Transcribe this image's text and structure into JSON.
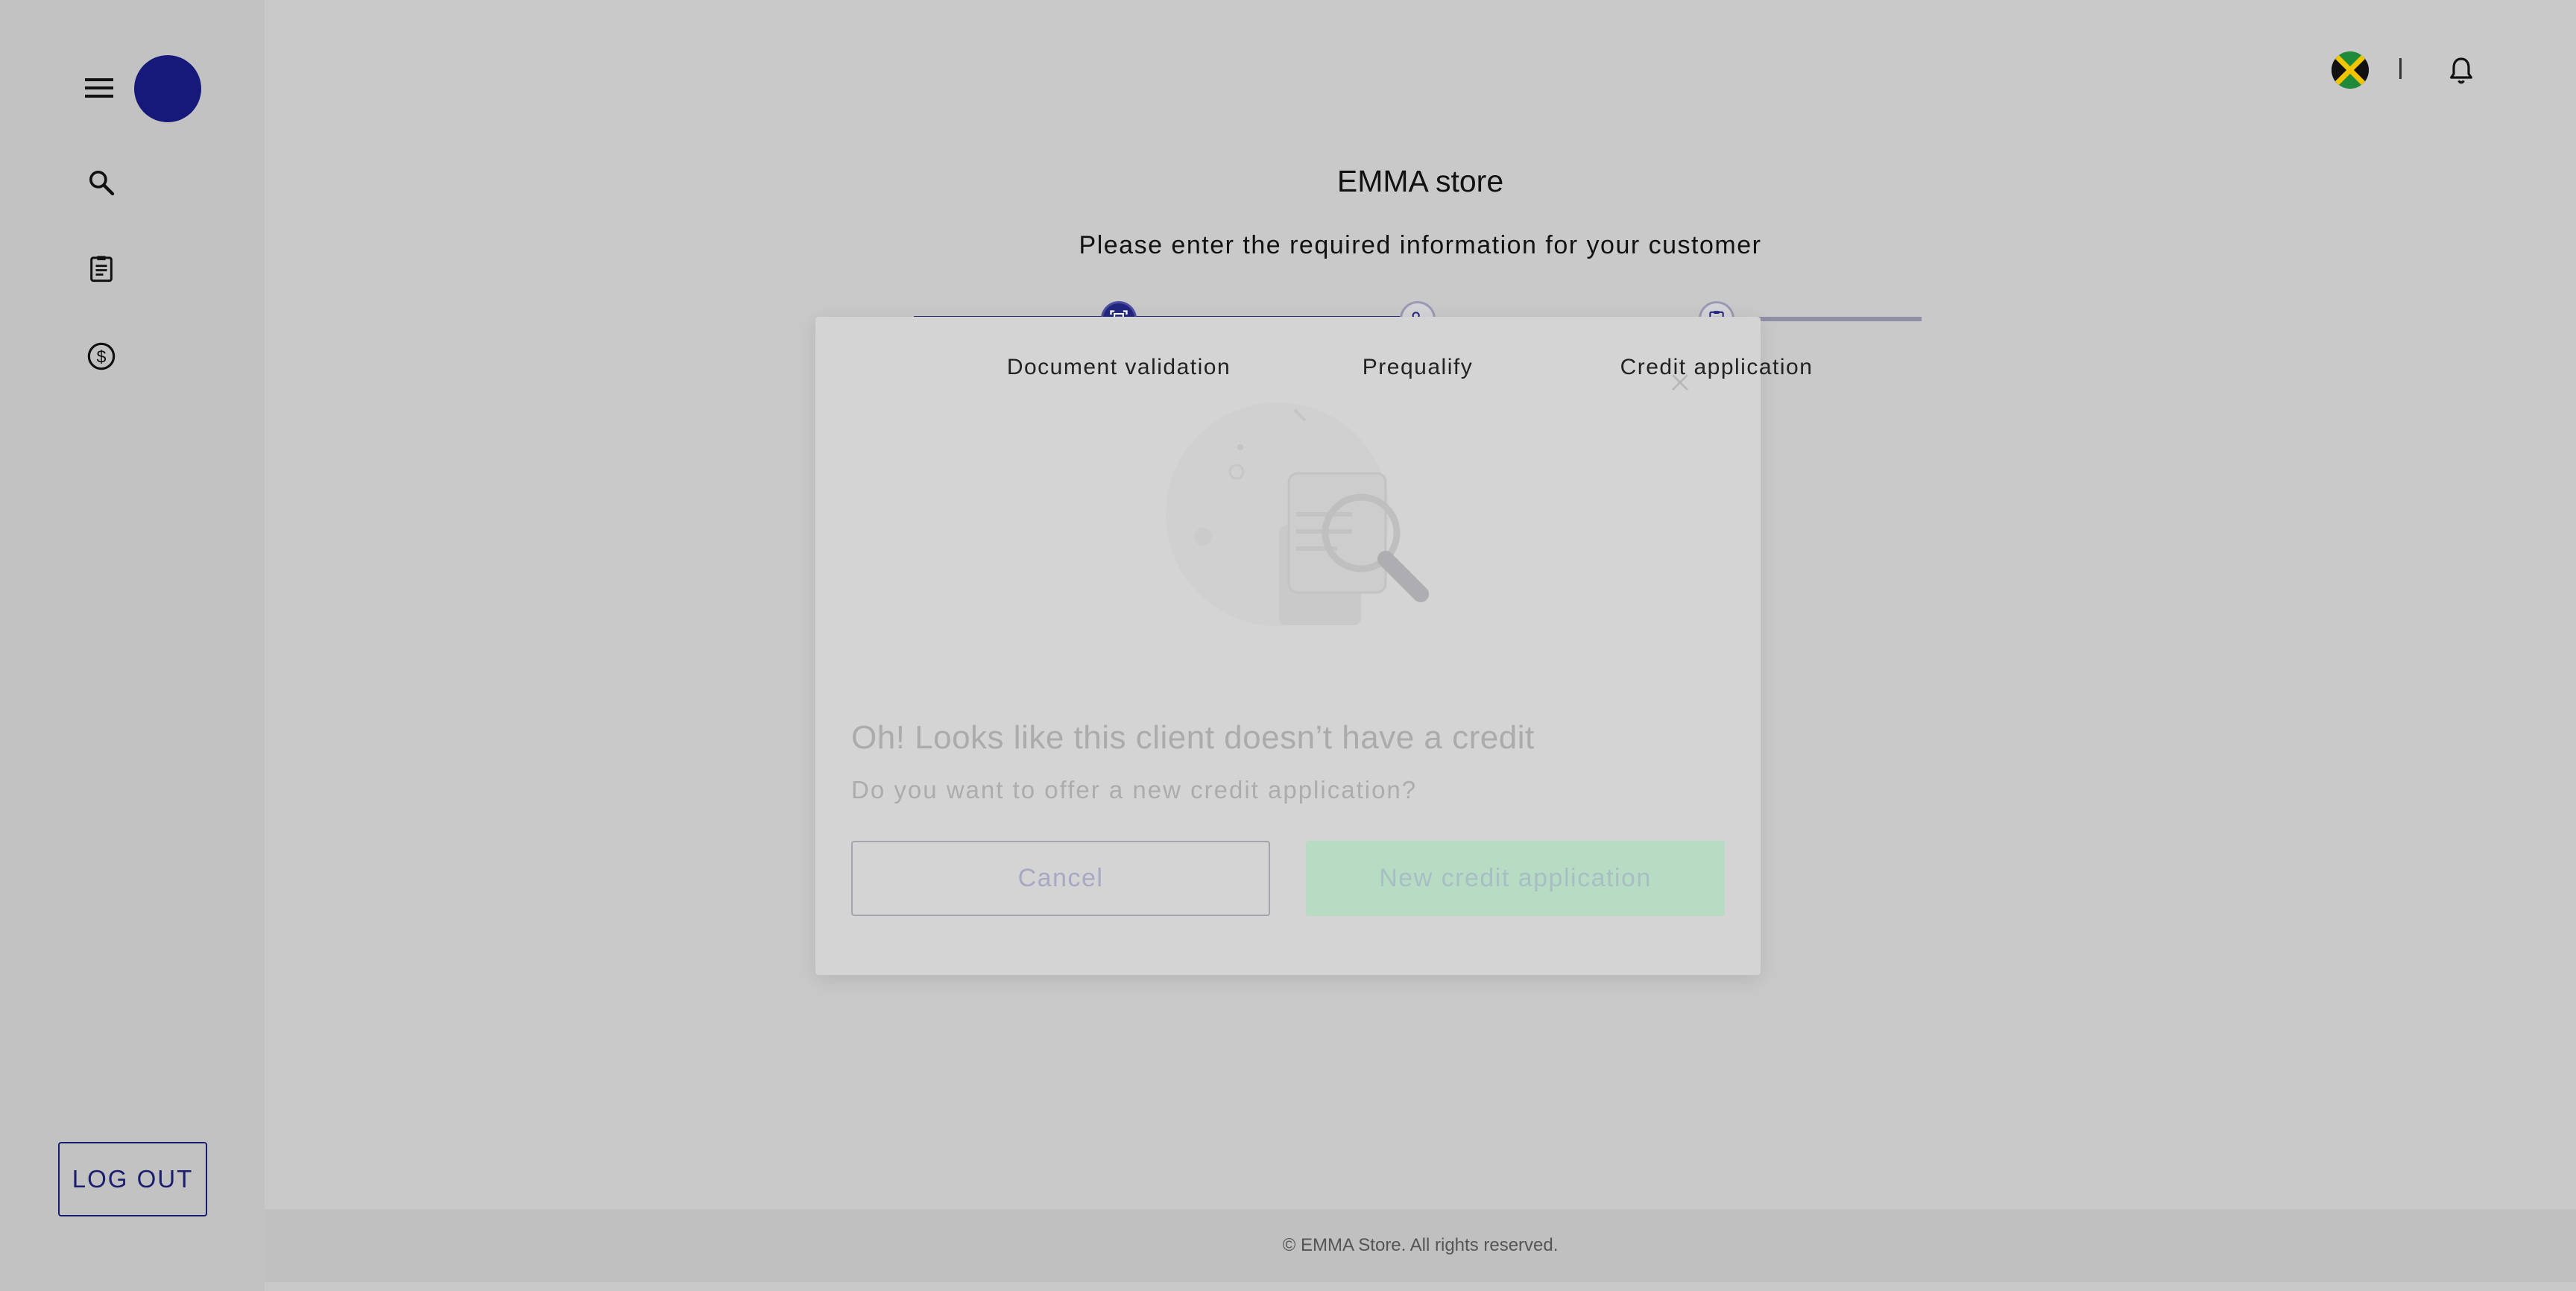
{
  "sidebar": {
    "menu_icon": "hamburger-icon",
    "avatar_color": "#16187a",
    "items": [
      {
        "icon": "search-icon"
      },
      {
        "icon": "clipboard-icon"
      },
      {
        "icon": "dollar-icon"
      }
    ],
    "logout_label": "LOG OUT"
  },
  "header": {
    "flag_icon": "jamaica-flag-icon",
    "bell_icon": "bell-icon"
  },
  "main": {
    "store_title": "EMMA store",
    "subtitle": "Please enter the required information for your customer",
    "steps": [
      {
        "label": "Document validation",
        "status": "active"
      },
      {
        "label": "Prequalify",
        "status": "inactive"
      },
      {
        "label": "Credit application",
        "status": "inactive"
      }
    ]
  },
  "modal": {
    "title": "Oh! Looks like this client doesn’t have a credit",
    "subtitle": "Do you want to offer a new credit application?",
    "cancel_label": "Cancel",
    "new_credit_label": "New credit application",
    "close_icon": "close-icon",
    "illustration": "document-search-illustration"
  },
  "footer": {
    "text": "© EMMA Store. All rights reserved."
  },
  "colors": {
    "brand": "#16187a",
    "stepper_active": "#23267e",
    "new_credit_button": "#b7dbc3"
  }
}
